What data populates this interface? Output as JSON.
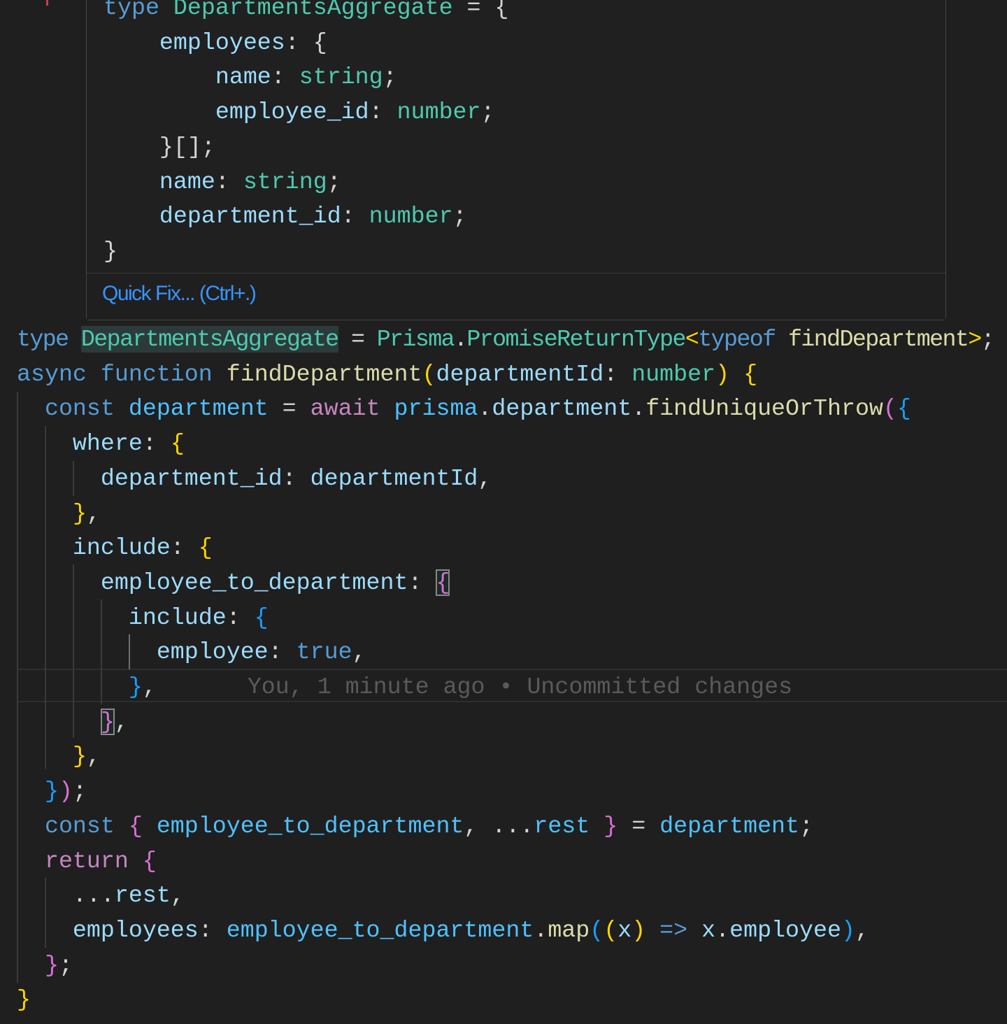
{
  "hover_popup": {
    "lines": [
      {
        "tokens": [
          {
            "text": "type ",
            "cls": "k"
          },
          {
            "text": "DepartmentsAggregate",
            "cls": "t"
          },
          {
            "text": " = {",
            "cls": "w"
          }
        ]
      },
      {
        "tokens": [
          {
            "text": "    employees",
            "cls": "v"
          },
          {
            "text": ": {",
            "cls": "w"
          }
        ]
      },
      {
        "tokens": [
          {
            "text": "        name",
            "cls": "v"
          },
          {
            "text": ": ",
            "cls": "w"
          },
          {
            "text": "string",
            "cls": "t"
          },
          {
            "text": ";",
            "cls": "w"
          }
        ]
      },
      {
        "tokens": [
          {
            "text": "        employee_id",
            "cls": "v"
          },
          {
            "text": ": ",
            "cls": "w"
          },
          {
            "text": "number",
            "cls": "t"
          },
          {
            "text": ";",
            "cls": "w"
          }
        ]
      },
      {
        "tokens": [
          {
            "text": "    }[];",
            "cls": "w"
          }
        ]
      },
      {
        "tokens": [
          {
            "text": "    name",
            "cls": "v"
          },
          {
            "text": ": ",
            "cls": "w"
          },
          {
            "text": "string",
            "cls": "t"
          },
          {
            "text": ";",
            "cls": "w"
          }
        ]
      },
      {
        "tokens": [
          {
            "text": "    department_id",
            "cls": "v"
          },
          {
            "text": ": ",
            "cls": "w"
          },
          {
            "text": "number",
            "cls": "t"
          },
          {
            "text": ";",
            "cls": "w"
          }
        ]
      },
      {
        "tokens": [
          {
            "text": "}",
            "cls": "w"
          }
        ]
      }
    ],
    "quick_fix_label": "Quick Fix... (Ctrl+.)"
  },
  "editor": {
    "blame": "You, 1 minute ago • Uncommitted changes",
    "lines": [
      {
        "tokens": [
          {
            "text": "type ",
            "cls": "k"
          },
          {
            "text": "DepartmentsAggregate",
            "cls": "t hl"
          },
          {
            "text": " = ",
            "cls": "w"
          },
          {
            "text": "Prisma",
            "cls": "t"
          },
          {
            "text": ".",
            "cls": "w"
          },
          {
            "text": "PromiseReturnType",
            "cls": "t"
          },
          {
            "text": "<",
            "cls": "b1"
          },
          {
            "text": "typeof ",
            "cls": "k"
          },
          {
            "text": "findDepartment",
            "cls": "f"
          },
          {
            "text": ">",
            "cls": "b1"
          },
          {
            "text": ";",
            "cls": "w"
          }
        ]
      },
      {
        "tokens": [
          {
            "text": "async ",
            "cls": "k"
          },
          {
            "text": "function ",
            "cls": "k"
          },
          {
            "text": "findDepartment",
            "cls": "f"
          },
          {
            "text": "(",
            "cls": "b1"
          },
          {
            "text": "departmentId",
            "cls": "v"
          },
          {
            "text": ": ",
            "cls": "w"
          },
          {
            "text": "number",
            "cls": "t"
          },
          {
            "text": ")",
            "cls": "b1"
          },
          {
            "text": " ",
            "cls": "w"
          },
          {
            "text": "{",
            "cls": "b1"
          }
        ]
      },
      {
        "tokens": [
          {
            "text": "  const ",
            "cls": "k"
          },
          {
            "text": "department",
            "cls": "c"
          },
          {
            "text": " = ",
            "cls": "w"
          },
          {
            "text": "await ",
            "cls": "p"
          },
          {
            "text": "prisma",
            "cls": "c"
          },
          {
            "text": ".",
            "cls": "w"
          },
          {
            "text": "department",
            "cls": "v"
          },
          {
            "text": ".",
            "cls": "w"
          },
          {
            "text": "findUniqueOrThrow",
            "cls": "f"
          },
          {
            "text": "(",
            "cls": "b2"
          },
          {
            "text": "{",
            "cls": "b3"
          }
        ]
      },
      {
        "tokens": [
          {
            "text": "    where",
            "cls": "v"
          },
          {
            "text": ": ",
            "cls": "w"
          },
          {
            "text": "{",
            "cls": "b1"
          }
        ]
      },
      {
        "tokens": [
          {
            "text": "      department_id",
            "cls": "v"
          },
          {
            "text": ": ",
            "cls": "w"
          },
          {
            "text": "departmentId",
            "cls": "v"
          },
          {
            "text": ",",
            "cls": "w"
          }
        ]
      },
      {
        "tokens": [
          {
            "text": "    ",
            "cls": "w"
          },
          {
            "text": "}",
            "cls": "b1"
          },
          {
            "text": ",",
            "cls": "w"
          }
        ]
      },
      {
        "tokens": [
          {
            "text": "    include",
            "cls": "v"
          },
          {
            "text": ": ",
            "cls": "w"
          },
          {
            "text": "{",
            "cls": "b1"
          }
        ]
      },
      {
        "tokens": [
          {
            "text": "      employee_to_department",
            "cls": "v"
          },
          {
            "text": ": ",
            "cls": "w"
          },
          {
            "text": "{",
            "cls": "b2 box"
          }
        ]
      },
      {
        "tokens": [
          {
            "text": "        include",
            "cls": "v"
          },
          {
            "text": ": ",
            "cls": "w"
          },
          {
            "text": "{",
            "cls": "b3"
          }
        ]
      },
      {
        "tokens": [
          {
            "text": "          employee",
            "cls": "v"
          },
          {
            "text": ": ",
            "cls": "w"
          },
          {
            "text": "true",
            "cls": "k"
          },
          {
            "text": ",",
            "cls": "w"
          }
        ]
      },
      {
        "tokens": [
          {
            "text": "        ",
            "cls": "w"
          },
          {
            "text": "}",
            "cls": "b3"
          },
          {
            "text": ",",
            "cls": "w"
          }
        ],
        "blame": true
      },
      {
        "tokens": [
          {
            "text": "      ",
            "cls": "w"
          },
          {
            "text": "}",
            "cls": "b2 box"
          },
          {
            "text": ",",
            "cls": "w"
          }
        ]
      },
      {
        "tokens": [
          {
            "text": "    ",
            "cls": "w"
          },
          {
            "text": "}",
            "cls": "b1"
          },
          {
            "text": ",",
            "cls": "w"
          }
        ]
      },
      {
        "tokens": [
          {
            "text": "  ",
            "cls": "w"
          },
          {
            "text": "}",
            "cls": "b3"
          },
          {
            "text": ")",
            "cls": "b2"
          },
          {
            "text": ";",
            "cls": "w"
          }
        ]
      },
      {
        "tokens": [
          {
            "text": "  const ",
            "cls": "k"
          },
          {
            "text": "{",
            "cls": "b2"
          },
          {
            "text": " ",
            "cls": "w"
          },
          {
            "text": "employee_to_department",
            "cls": "c"
          },
          {
            "text": ", ...",
            "cls": "w"
          },
          {
            "text": "rest",
            "cls": "c"
          },
          {
            "text": " ",
            "cls": "w"
          },
          {
            "text": "}",
            "cls": "b2"
          },
          {
            "text": " = ",
            "cls": "w"
          },
          {
            "text": "department",
            "cls": "c"
          },
          {
            "text": ";",
            "cls": "w"
          }
        ]
      },
      {
        "tokens": [
          {
            "text": "  return ",
            "cls": "p"
          },
          {
            "text": "{",
            "cls": "b2"
          }
        ]
      },
      {
        "tokens": [
          {
            "text": "    ...",
            "cls": "w"
          },
          {
            "text": "rest",
            "cls": "v"
          },
          {
            "text": ",",
            "cls": "w"
          }
        ]
      },
      {
        "tokens": [
          {
            "text": "    employees",
            "cls": "v"
          },
          {
            "text": ": ",
            "cls": "w"
          },
          {
            "text": "employee_to_department",
            "cls": "c"
          },
          {
            "text": ".",
            "cls": "w"
          },
          {
            "text": "map",
            "cls": "f"
          },
          {
            "text": "(",
            "cls": "b3"
          },
          {
            "text": "(",
            "cls": "b1"
          },
          {
            "text": "x",
            "cls": "v"
          },
          {
            "text": ")",
            "cls": "b1"
          },
          {
            "text": " => ",
            "cls": "k"
          },
          {
            "text": "x",
            "cls": "v"
          },
          {
            "text": ".",
            "cls": "w"
          },
          {
            "text": "employee",
            "cls": "v"
          },
          {
            "text": ")",
            "cls": "b3"
          },
          {
            "text": ",",
            "cls": "w"
          }
        ]
      },
      {
        "tokens": [
          {
            "text": "  ",
            "cls": "w"
          },
          {
            "text": "}",
            "cls": "b2"
          },
          {
            "text": ";",
            "cls": "w"
          }
        ]
      },
      {
        "tokens": [
          {
            "text": "}",
            "cls": "b1"
          }
        ]
      }
    ]
  }
}
